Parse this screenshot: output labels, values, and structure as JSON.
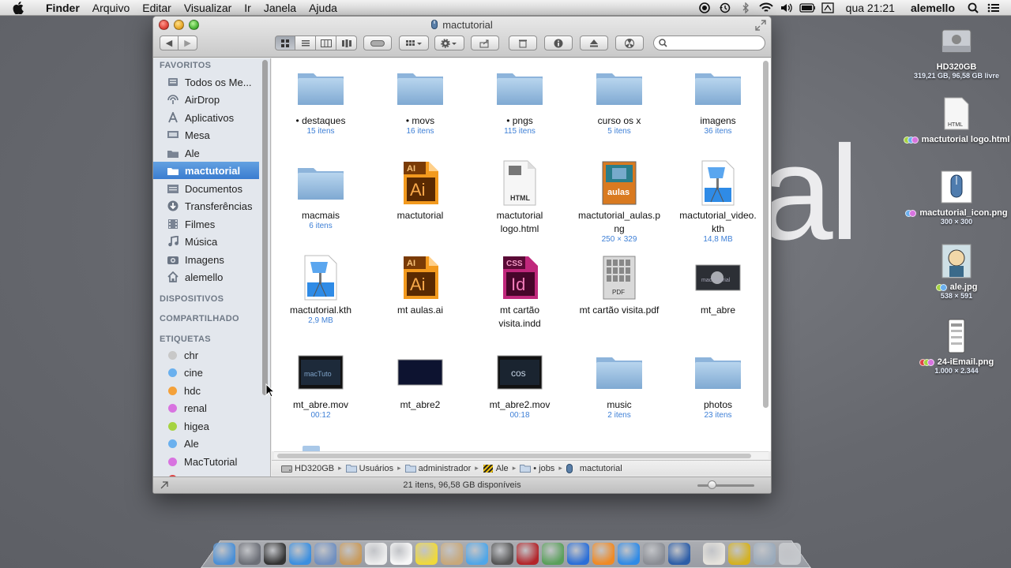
{
  "menubar": {
    "app_name": "Finder",
    "menus": [
      "Arquivo",
      "Editar",
      "Visualizar",
      "Ir",
      "Janela",
      "Ajuda"
    ],
    "clock": "qua 21:21",
    "user": "alemello"
  },
  "window": {
    "title": "mactutorial",
    "search_placeholder": ""
  },
  "sidebar": {
    "favorites_header": "FAVORITOS",
    "favorites": [
      {
        "label": "Todos os Me...",
        "icon": "all-files-icon"
      },
      {
        "label": "AirDrop",
        "icon": "airdrop-icon"
      },
      {
        "label": "Aplicativos",
        "icon": "applications-icon"
      },
      {
        "label": "Mesa",
        "icon": "desktop-icon"
      },
      {
        "label": "Ale",
        "icon": "folder-icon"
      },
      {
        "label": "mactutorial",
        "icon": "folder-icon"
      },
      {
        "label": "Documentos",
        "icon": "documents-icon"
      },
      {
        "label": "Transferências",
        "icon": "downloads-icon"
      },
      {
        "label": "Filmes",
        "icon": "movies-icon"
      },
      {
        "label": "Música",
        "icon": "music-icon"
      },
      {
        "label": "Imagens",
        "icon": "pictures-icon"
      },
      {
        "label": "alemello",
        "icon": "home-icon"
      }
    ],
    "devices_header": "DISPOSITIVOS",
    "shared_header": "COMPARTILHADO",
    "tags_header": "ETIQUETAS",
    "tags": [
      {
        "label": "chr",
        "color": "#c8c8c8"
      },
      {
        "label": "cine",
        "color": "#6ab0ee"
      },
      {
        "label": "hdc",
        "color": "#f4a13a"
      },
      {
        "label": "renal",
        "color": "#d873e0"
      },
      {
        "label": "higea",
        "color": "#a6d341"
      },
      {
        "label": "Ale",
        "color": "#6ab0ee"
      },
      {
        "label": "MacTutorial",
        "color": "#d873e0"
      }
    ]
  },
  "files": [
    {
      "name": "• destaques",
      "info": "15 itens",
      "type": "folder"
    },
    {
      "name": "• movs",
      "info": "16 itens",
      "type": "folder"
    },
    {
      "name": "• pngs",
      "info": "115 itens",
      "type": "folder"
    },
    {
      "name": "curso os x",
      "info": "5 itens",
      "type": "folder"
    },
    {
      "name": "imagens",
      "info": "36 itens",
      "type": "folder"
    },
    {
      "name": "macmais",
      "info": "6 itens",
      "type": "folder"
    },
    {
      "name": "mactutorial",
      "info": "",
      "type": "ai"
    },
    {
      "name": "mactutorial\nlogo.html",
      "info": "",
      "type": "html"
    },
    {
      "name": "mactutorial_aulas.p\nng",
      "info": "250 × 329",
      "type": "png-aulas"
    },
    {
      "name": "mactutorial_video.\nkth",
      "info": "14,8 MB",
      "type": "keynote"
    },
    {
      "name": "mactutorial.kth",
      "info": "2,9 MB",
      "type": "keynote"
    },
    {
      "name": "mt aulas.ai",
      "info": "",
      "type": "ai"
    },
    {
      "name": "mt cartão\nvisita.indd",
      "info": "",
      "type": "indd"
    },
    {
      "name": "mt cartão visita.pdf",
      "info": "",
      "type": "pdf"
    },
    {
      "name": "mt_abre",
      "info": "",
      "type": "image-dark"
    },
    {
      "name": "mt_abre.mov",
      "info": "00:12",
      "type": "movie"
    },
    {
      "name": "mt_abre2",
      "info": "",
      "type": "image-navy"
    },
    {
      "name": "mt_abre2.mov",
      "info": "00:18",
      "type": "movie2"
    },
    {
      "name": "music",
      "info": "2 itens",
      "type": "folder"
    },
    {
      "name": "photos",
      "info": "23 itens",
      "type": "folder"
    }
  ],
  "pathbar": [
    {
      "label": "HD320GB",
      "icon": "hard-drive-icon"
    },
    {
      "label": "Usuários",
      "icon": "folder-icon"
    },
    {
      "label": "administrador",
      "icon": "folder-icon"
    },
    {
      "label": "Ale",
      "icon": "striped-folder-icon"
    },
    {
      "label": "• jobs",
      "icon": "folder-icon"
    },
    {
      "label": "mactutorial",
      "icon": "mouse-icon"
    }
  ],
  "status": "21 itens, 96,58 GB disponíveis",
  "desktop": {
    "background_text": "al",
    "icons": [
      {
        "name": "HD320GB",
        "info": "319,21 GB, 96,58 GB livre",
        "icon": "hard-drive-icon",
        "tags": []
      },
      {
        "name": "mactutorial logo.html",
        "info": "",
        "icon": "html-file-icon",
        "tags": [
          "#a6d341",
          "#6ab0ee",
          "#d873e0"
        ]
      },
      {
        "name": "mactutorial_icon.png",
        "info": "300 × 300",
        "icon": "mouse-image-icon",
        "tags": [
          "#6ab0ee",
          "#d873e0"
        ]
      },
      {
        "name": "ale.jpg",
        "info": "538 × 591",
        "icon": "portrait-icon",
        "tags": [
          "#a6d341",
          "#6ab0ee"
        ]
      },
      {
        "name": "24-iEmail.png",
        "info": "1.000 × 2.344",
        "icon": "phone-screenshot-icon",
        "tags": [
          "#e04444",
          "#a6d341",
          "#d873e0"
        ]
      }
    ]
  },
  "dock": [
    "finder-icon",
    "launchpad-icon",
    "mission-control-icon",
    "safari-icon",
    "mail-icon",
    "contacts-icon",
    "calendar-icon",
    "notes-icon",
    "reminders-icon",
    "preview-icon",
    "messages-icon",
    "facetime-icon",
    "photobooth-icon",
    "iphoto-icon",
    "itunes-icon",
    "ibooks-icon",
    "app-store-icon",
    "system-preferences-icon",
    "quicktime-icon",
    "home-folder-icon",
    "striped-folder-icon",
    "documents-folder-icon",
    "trash-icon"
  ],
  "colors": {
    "accent": "#3a7cd0",
    "info_blue": "#3d7fd6"
  }
}
